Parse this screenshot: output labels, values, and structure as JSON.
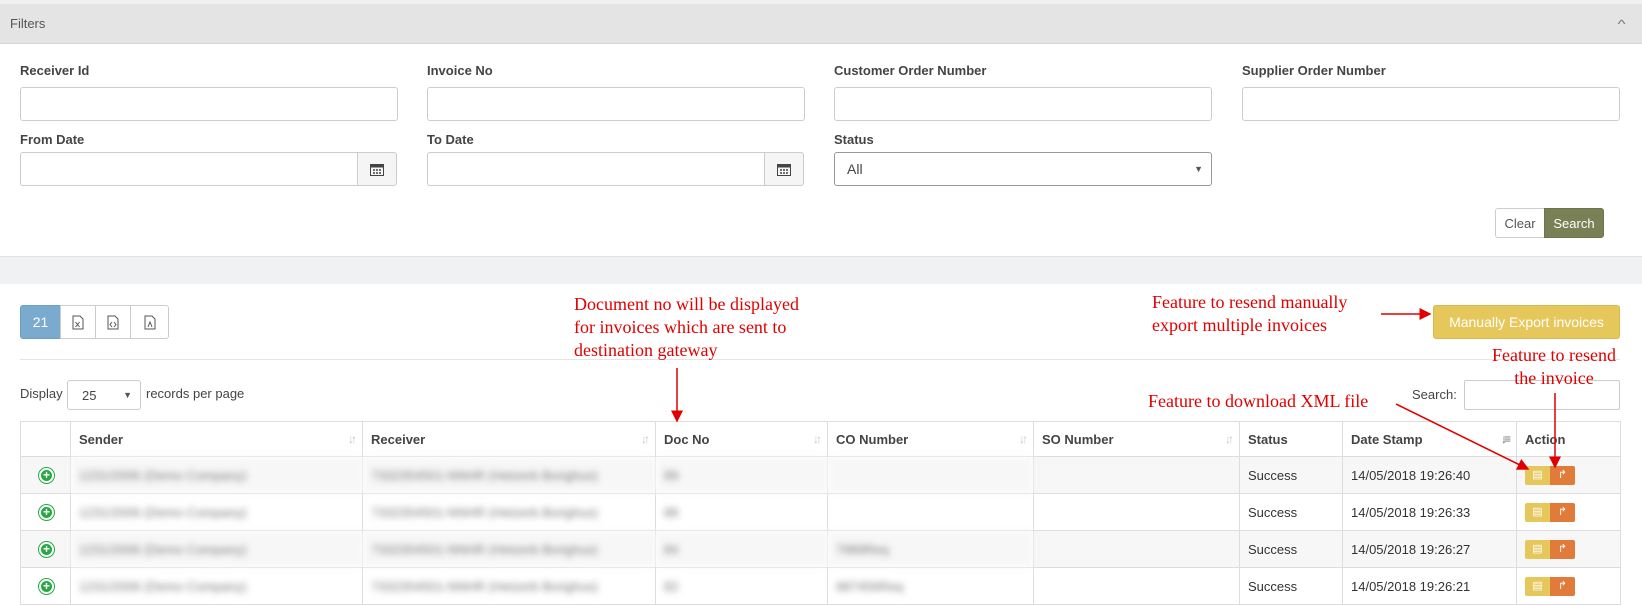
{
  "filters": {
    "title": "Filters",
    "fields": {
      "receiver_id": "Receiver Id",
      "invoice_no": "Invoice No",
      "customer_order_number": "Customer Order Number",
      "supplier_order_number": "Supplier Order Number",
      "from_date": "From Date",
      "to_date": "To Date",
      "status": "Status"
    },
    "status_value": "All",
    "clear_label": "Clear",
    "search_label": "Search"
  },
  "results": {
    "count": "21",
    "export_label": "Manually Export invoices",
    "display_label": "Display",
    "page_size": "25",
    "records_label": "records per page",
    "search_label": "Search:",
    "columns": [
      "Sender",
      "Receiver",
      "Doc No",
      "CO Number",
      "SO Number",
      "Status",
      "Date Stamp",
      "Action"
    ],
    "rows": [
      {
        "sender": "1231/2006 (Demo Company)",
        "receiver": "7332354501-NNHR (Hetzerb Borighus)",
        "doc_no": "89",
        "co": "",
        "so": "",
        "status": "Success",
        "date": "14/05/2018 19:26:40"
      },
      {
        "sender": "1231/2006 (Demo Company)",
        "receiver": "7332354501-NNHR (Hetzerb Borighus)",
        "doc_no": "88",
        "co": "",
        "so": "",
        "status": "Success",
        "date": "14/05/2018 19:26:33"
      },
      {
        "sender": "1231/2006 (Demo Company)",
        "receiver": "7332354501-NNHR (Hetzerb Borighus)",
        "doc_no": "84",
        "co": "7989Req",
        "so": "",
        "status": "Success",
        "date": "14/05/2018 19:26:27"
      },
      {
        "sender": "1231/2006 (Demo Company)",
        "receiver": "7332354501-NNHR (Hetzerb Borighus)",
        "doc_no": "82",
        "co": "987456Req",
        "so": "",
        "status": "Success",
        "date": "14/05/2018 19:26:21"
      }
    ]
  },
  "annotations": {
    "doc_no_line1": "Document no will be displayed",
    "doc_no_line2": "for invoices which are sent to",
    "doc_no_line3": "destination gateway",
    "resend_multi_line1": "Feature to resend manually",
    "resend_multi_line2": "export multiple invoices",
    "resend_one_line1": "Feature to resend",
    "resend_one_line2": "the invoice",
    "download_xml": "Feature to download XML file"
  },
  "colors": {
    "annotation": "#e00000",
    "search_button": "#7a8055",
    "export_button": "#e6c75c",
    "resend_button": "#e07b3a",
    "count_button": "#7aabcf",
    "expand_icon": "#27a844"
  }
}
